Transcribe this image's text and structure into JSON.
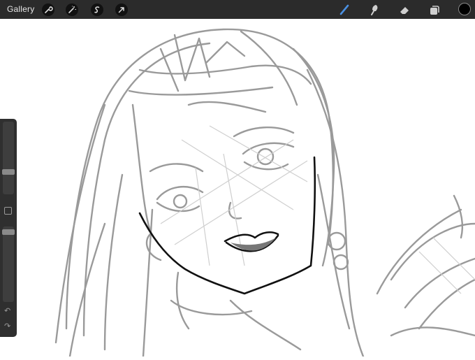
{
  "toolbar": {
    "gallery_label": "Gallery",
    "left_tools": [
      "wrench-icon",
      "magic-wand-icon",
      "selection-icon",
      "transform-arrow-icon"
    ],
    "right_tools": [
      "brush-icon",
      "smudge-icon",
      "eraser-icon",
      "layers-icon"
    ],
    "active_tool": "brush-icon",
    "active_color": "#4a90e2",
    "current_color": "#000000"
  },
  "sidebar": {
    "brush_size_level": 0.28,
    "opacity_level": 0.08,
    "undo_symbol": "↶",
    "redo_symbol": "↷"
  }
}
